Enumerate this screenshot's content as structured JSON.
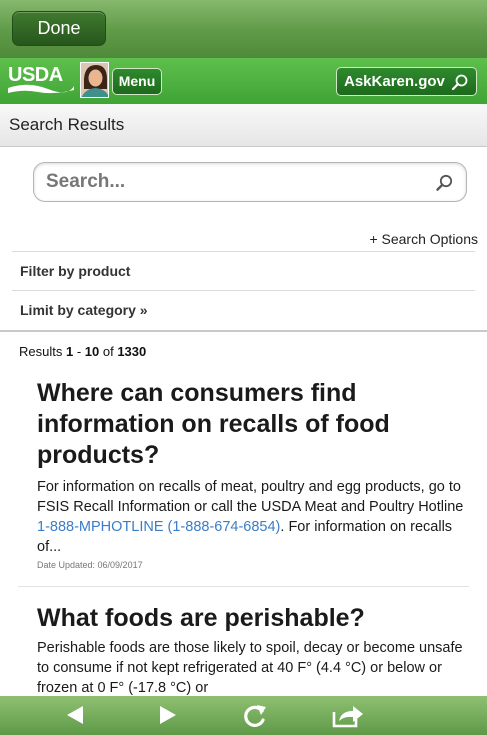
{
  "navbar": {
    "done_label": "Done"
  },
  "header": {
    "logo_text": "USDA",
    "menu_label": "Menu",
    "ask_label": "AskKaren.gov"
  },
  "page_title": "Search Results",
  "search": {
    "placeholder": "Search...",
    "options_label": "+ Search Options"
  },
  "filters": {
    "product_label": "Filter by product",
    "category_label": "Limit by category »"
  },
  "results_summary": {
    "prefix": "Results ",
    "start": "1",
    "dash": " - ",
    "end": "10",
    "of": " of ",
    "total": "1330"
  },
  "results": [
    {
      "title": "Where can consumers find information on recalls of food products?",
      "snippet_before": "For information on recalls of meat, poultry and egg products, go to FSIS Recall Information or call the USDA Meat and Poultry Hotline ",
      "hotline": "1-888-MPHOTLINE (1-888-674-6854)",
      "snippet_after": ". For information on recalls of...",
      "date": "Date Updated: 06/09/2017"
    },
    {
      "title": "What foods are perishable?",
      "snippet": "Perishable foods are those likely to spoil, decay or become unsafe to consume if not kept refrigerated at 40 F° (4.4 °C) or below or frozen at 0 F° (-17.8 °C) or"
    }
  ],
  "toolbar": {
    "icons": [
      "back-icon",
      "forward-icon",
      "refresh-icon",
      "share-icon"
    ]
  },
  "colors": {
    "nav_green": "#5e9a47",
    "usda_green": "#4cae3f",
    "button_dark_green": "#1d6a1c",
    "link_blue": "#3a7dc9"
  }
}
